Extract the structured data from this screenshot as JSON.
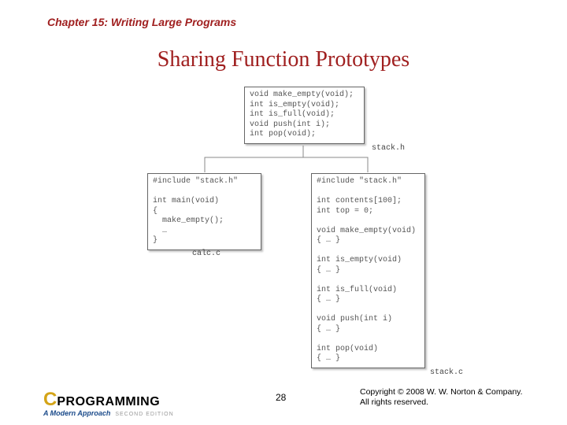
{
  "header": {
    "chapter": "Chapter 15: Writing Large Programs",
    "title": "Sharing Function Prototypes"
  },
  "boxes": {
    "stack_h": "void make_empty(void);\nint is_empty(void);\nint is_full(void);\nvoid push(int i);\nint pop(void);",
    "stack_h_label": "stack.h",
    "calc_c": "#include \"stack.h\"\n\nint main(void)\n{\n  make_empty();\n  …\n}",
    "calc_c_label": "calc.c",
    "stack_c": "#include \"stack.h\"\n\nint contents[100];\nint top = 0;\n\nvoid make_empty(void)\n{ … }\n\nint is_empty(void)\n{ … }\n\nint is_full(void)\n{ … }\n\nvoid push(int i)\n{ … }\n\nint pop(void)\n{ … }",
    "stack_c_label": "stack.c"
  },
  "footer": {
    "logo_c": "C",
    "logo_word": "PROGRAMMING",
    "logo_sub": "A Modern Approach",
    "logo_ed": "SECOND EDITION",
    "page": "28",
    "copyright1": "Copyright © 2008 W. W. Norton & Company.",
    "copyright2": "All rights reserved."
  }
}
